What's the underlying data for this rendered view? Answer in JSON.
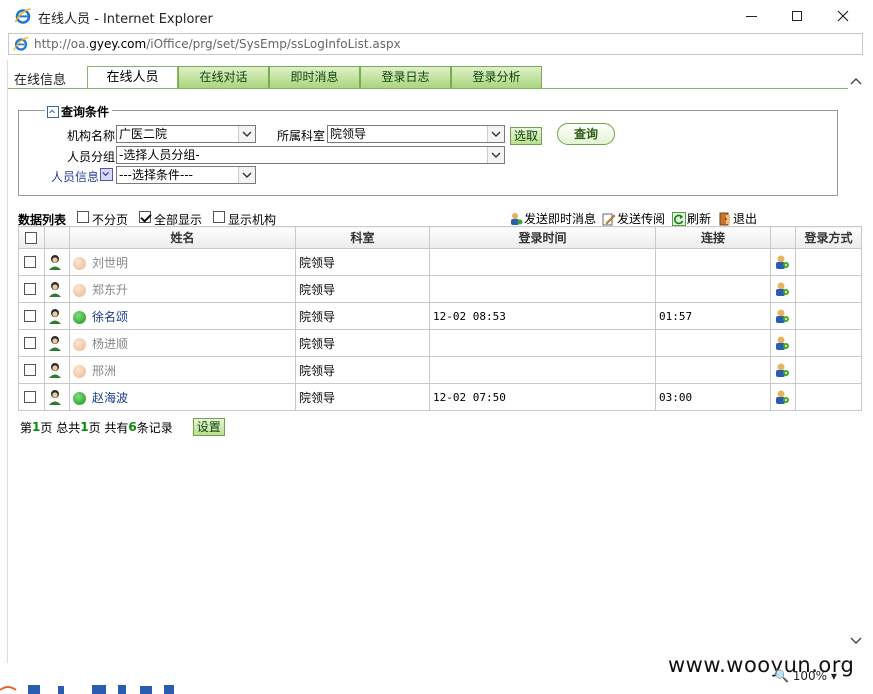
{
  "window": {
    "title": "在线人员 - Internet Explorer",
    "url_prefix": "http://oa.",
    "url_host": "gyey.com",
    "url_path": "/iOffice/prg/set/SysEmp/ssLogInfoList.aspx"
  },
  "tabs": [
    {
      "label": "在线信息",
      "active": false,
      "style": "plain"
    },
    {
      "label": "在线人员",
      "active": true
    },
    {
      "label": "在线对话",
      "active": false
    },
    {
      "label": "即时消息",
      "active": false
    },
    {
      "label": "登录日志",
      "active": false
    },
    {
      "label": "登录分析",
      "active": false
    }
  ],
  "query": {
    "legend": "查询条件",
    "org_label": "机构名称",
    "org_value": "广医二院",
    "dept_label": "所属科室",
    "dept_value": "院领导",
    "select_button": "选取",
    "query_button": "查询",
    "group_label": "人员分组",
    "group_value": "-选择人员分组-",
    "info_label": "人员信息",
    "info_value": "---选择条件---"
  },
  "list": {
    "title": "数据列表",
    "no_paging": "不分页",
    "show_all": "全部显示",
    "show_org": "显示机构",
    "actions": [
      "发送即时消息",
      "发送传阅",
      "刷新",
      "退出"
    ]
  },
  "columns": [
    "姓名",
    "科室",
    "登录时间",
    "连接",
    "登录方式"
  ],
  "rows": [
    {
      "name": "刘世明",
      "dept": "院领导",
      "login_time": "",
      "conn": "",
      "online": false
    },
    {
      "name": "郑东升",
      "dept": "院领导",
      "login_time": "",
      "conn": "",
      "online": false
    },
    {
      "name": "徐名颂",
      "dept": "院领导",
      "login_time": "12-02 08:53",
      "conn": "01:57",
      "online": true
    },
    {
      "name": "杨进顺",
      "dept": "院领导",
      "login_time": "",
      "conn": "",
      "online": false
    },
    {
      "name": "邢洲",
      "dept": "院领导",
      "login_time": "",
      "conn": "",
      "online": false
    },
    {
      "name": "赵海波",
      "dept": "院领导",
      "login_time": "12-02 07:50",
      "conn": "03:00",
      "online": true
    }
  ],
  "pager": {
    "p1": "第",
    "page": "1",
    "p2": "页 总共",
    "total_pages": "1",
    "p3": "页 共有",
    "count": "6",
    "p4": "条记录",
    "settings_button": "设置"
  },
  "status": {
    "zoom": "100%",
    "watermark": "www.wooyun.org"
  }
}
